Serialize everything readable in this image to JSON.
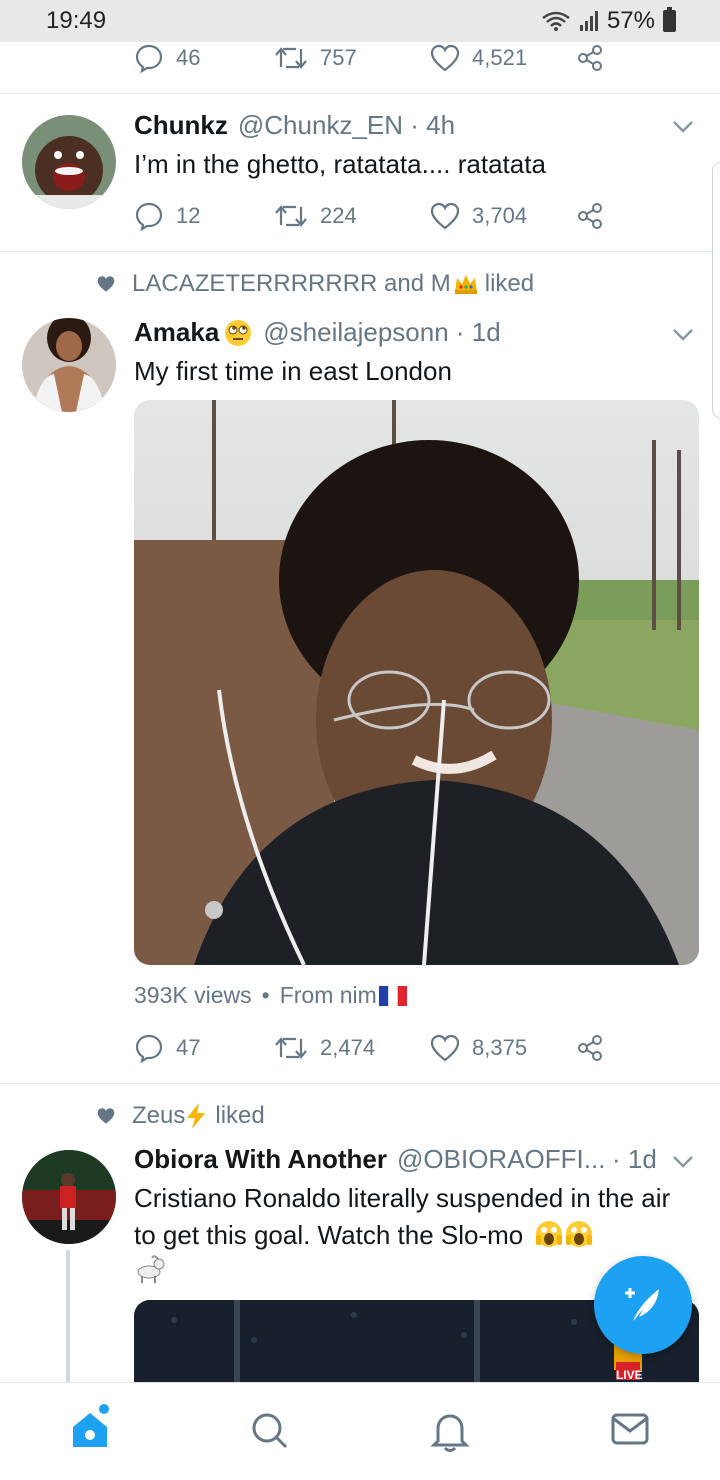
{
  "status_bar": {
    "time": "19:49",
    "battery": "57%"
  },
  "tweets": [
    {
      "replies": "46",
      "retweets": "757",
      "likes": "4,521"
    },
    {
      "name": "Chunkz",
      "handle": "@Chunkz_EN · 4h",
      "text": "I’m in the ghetto, ratatata.... ratatata",
      "replies": "12",
      "retweets": "224",
      "likes": "3,704"
    },
    {
      "liked_by": "LACAZETERRRRRRR and M",
      "name": "Amaka",
      "handle": "@sheilajepsonn · 1d",
      "text": "My first time in east London",
      "views": "393K views",
      "from": "From nim",
      "replies": "47",
      "retweets": "2,474",
      "likes": "8,375"
    },
    {
      "liked_by": "Zeus",
      "name": "Obiora With Another",
      "handle": "@OBIORAOFFI...",
      "time": "· 1d",
      "text": "Cristiano Ronaldo literally suspended in the air to get this goal. Watch the Slo-mo",
      "video_badge": "LIVE"
    }
  ],
  "icons": {
    "reply": "reply-icon",
    "retweet": "retweet-icon",
    "like": "heart-icon",
    "share": "share-icon",
    "chevron": "chevron-down-icon",
    "compose": "compose-icon",
    "nav": [
      "home-icon",
      "search-icon",
      "notifications-icon",
      "messages-icon"
    ]
  },
  "colors": {
    "accent": "#1da1f2",
    "secondary_text": "#657786",
    "divider": "#e1e8ed"
  }
}
